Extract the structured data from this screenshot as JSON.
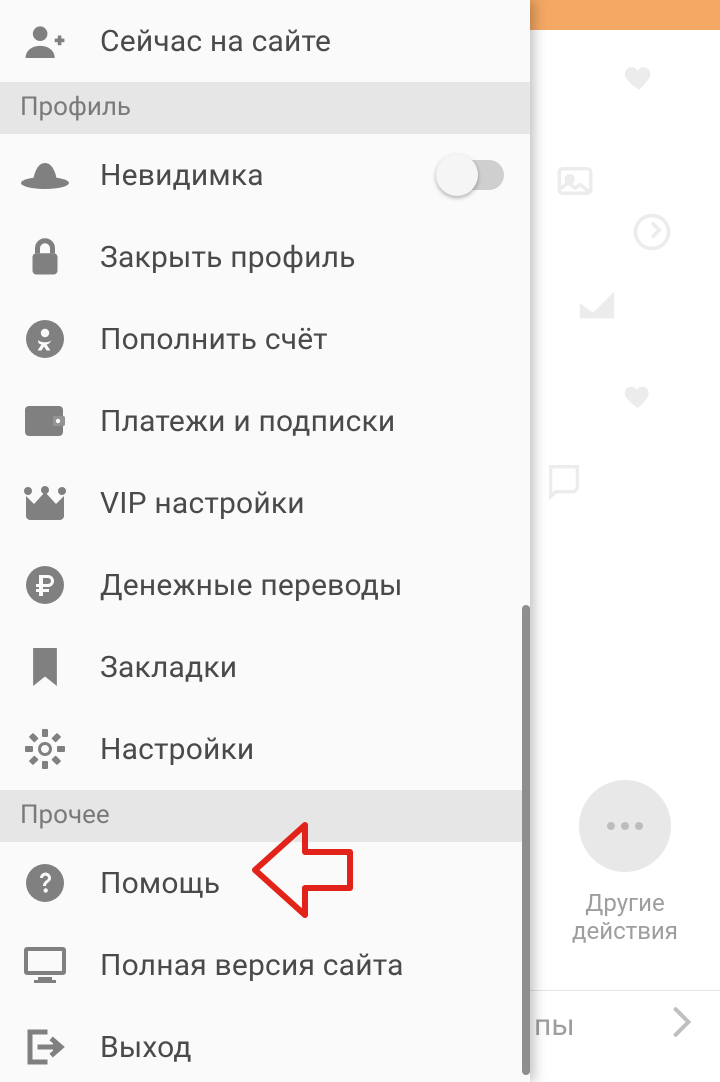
{
  "drawer": {
    "top_item": {
      "label": "Сейчас на сайте"
    },
    "section_profile": {
      "title": "Профиль"
    },
    "invisible": {
      "label": "Невидимка",
      "toggle_on": false
    },
    "close_profile": {
      "label": "Закрыть профиль"
    },
    "topup": {
      "label": "Пополнить счёт"
    },
    "payments": {
      "label": "Платежи и подписки"
    },
    "vip": {
      "label": "VIP настройки"
    },
    "transfers": {
      "label": "Денежные переводы"
    },
    "bookmarks": {
      "label": "Закладки"
    },
    "settings": {
      "label": "Настройки"
    },
    "section_other": {
      "title": "Прочее"
    },
    "help": {
      "label": "Помощь"
    },
    "full": {
      "label": "Полная версия сайта"
    },
    "logout": {
      "label": "Выход"
    }
  },
  "background": {
    "other_actions_line1": "Другие",
    "other_actions_line2": "действия",
    "bottom_fragment": "пы"
  },
  "colors": {
    "header": "#f4a864",
    "icon": "#808080",
    "text": "#4a4a4a",
    "section_bg": "#e6e6e6",
    "annotation": "#e2231a"
  }
}
